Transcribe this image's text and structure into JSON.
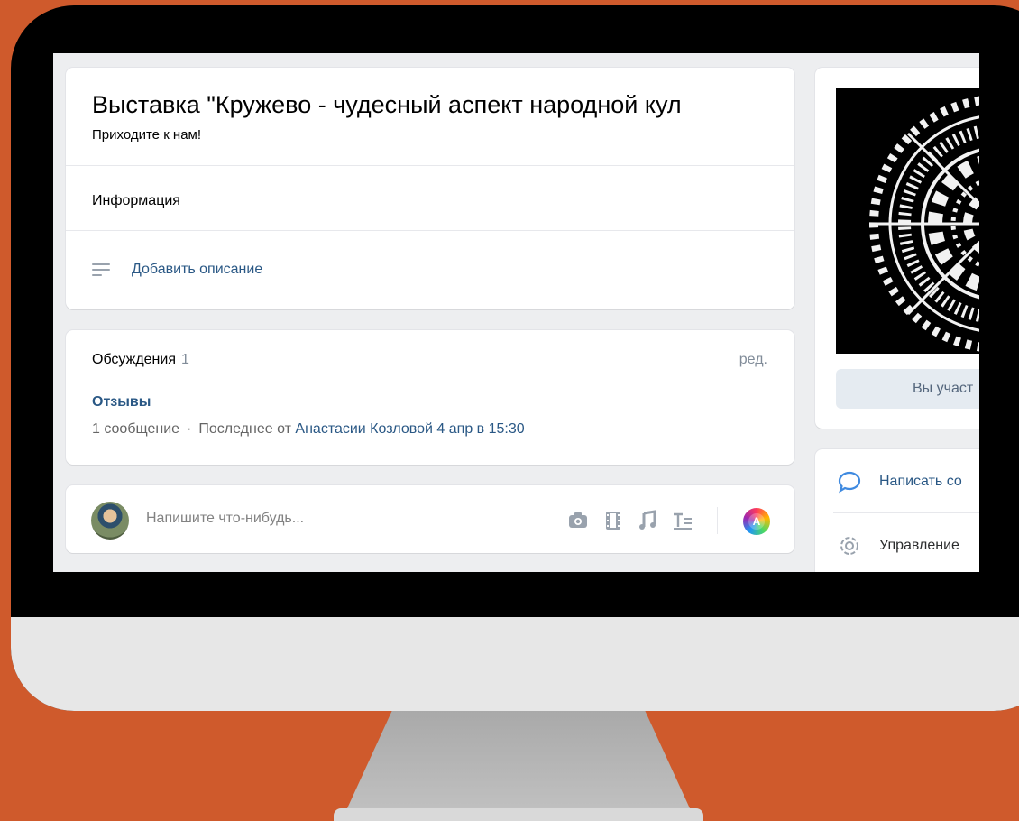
{
  "event": {
    "title": "Выставка \"Кружево - чудесный аспект народной кул",
    "subtitle": "Приходите к нам!",
    "info_label": "Информация",
    "add_description": "Добавить описание"
  },
  "discussions": {
    "title": "Обсуждения",
    "count": "1",
    "edit_label": "ред.",
    "topic": "Отзывы",
    "messages": "1 сообщение",
    "separator": "·",
    "last_from": "Последнее от",
    "author": "Анастасии Козловой",
    "date": "4 апр в 15:30"
  },
  "composer": {
    "placeholder": "Напишите что-нибудь...",
    "attachments": [
      "camera-icon",
      "film-icon",
      "music-icon",
      "text-format-icon"
    ],
    "avatar_button_letter": "A"
  },
  "sidebar": {
    "join_button": "Вы участ",
    "actions": [
      {
        "icon": "message-bubble-icon",
        "label": "Написать со"
      },
      {
        "icon": "gear-icon",
        "label": "Управление"
      }
    ]
  },
  "colors": {
    "background_orange": "#cf5a2c",
    "link_blue": "#2a5885",
    "page_gray": "#edeef0"
  }
}
